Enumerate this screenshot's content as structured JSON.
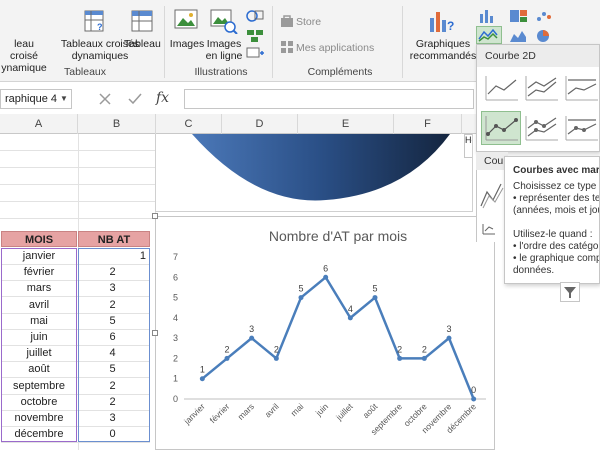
{
  "ribbon": {
    "tables": {
      "pivot_partial": "leau croisé",
      "pivot_partial2": "ynamique",
      "recommended_pivot_line1": "Tableaux croisés",
      "recommended_pivot_line2": "dynamiques",
      "table_partial": "Tableau",
      "group_label": "Tableaux"
    },
    "illustrations": {
      "images": "Images",
      "online_images_line1": "Images",
      "online_images_line2": "en ligne",
      "group_label": "Illustrations"
    },
    "addins": {
      "store": "Store",
      "my_apps": "Mes applications",
      "group_label": "Compléments"
    },
    "charts": {
      "recommended_line1": "Graphiques",
      "recommended_line2": "recommandés"
    }
  },
  "formula_bar": {
    "namebox": "raphique 4",
    "fx": "fx"
  },
  "columns": [
    "A",
    "B",
    "C",
    "D",
    "E",
    "F"
  ],
  "table": {
    "header_mois": "MOIS",
    "header_nb": "NB AT",
    "rows": [
      {
        "mois": "janvier",
        "nb": "1"
      },
      {
        "mois": "février",
        "nb": "2"
      },
      {
        "mois": "mars",
        "nb": "3"
      },
      {
        "mois": "avril",
        "nb": "2"
      },
      {
        "mois": "mai",
        "nb": "5"
      },
      {
        "mois": "juin",
        "nb": "6"
      },
      {
        "mois": "juillet",
        "nb": "4"
      },
      {
        "mois": "août",
        "nb": "5"
      },
      {
        "mois": "septembre",
        "nb": "2"
      },
      {
        "mois": "octobre",
        "nb": "2"
      },
      {
        "mois": "novembre",
        "nb": "3"
      },
      {
        "mois": "décembre",
        "nb": "0"
      }
    ]
  },
  "dropdown": {
    "header_2d": "Courbe 2D",
    "header_3d_partial": "Cou"
  },
  "tooltip": {
    "title": "Courbes avec marq",
    "lines": [
      "Choisissez ce type d",
      "• représenter des ten",
      "(années, mois et jou",
      "",
      "Utilisez-le quand :",
      "• l'ordre des catégor",
      "• le graphique comp",
      "données."
    ]
  },
  "chart_data": {
    "type": "line",
    "title": "Nombre d'AT par mois",
    "categories": [
      "janvier",
      "février",
      "mars",
      "avril",
      "mai",
      "juin",
      "juillet",
      "août",
      "septembre",
      "octobre",
      "novembre",
      "décembre"
    ],
    "values": [
      1,
      2,
      3,
      2,
      5,
      6,
      4,
      5,
      2,
      2,
      3,
      0
    ],
    "ylim": [
      0,
      7
    ],
    "yticks": [
      0,
      1,
      2,
      3,
      4,
      5,
      6,
      7
    ],
    "grid": false,
    "data_labels": true,
    "line_color": "#4a7ebb"
  },
  "colors": {
    "header_fill": "#e6a3a3",
    "series": "#4a7ebb",
    "selected_thumb": "#cfe5cf"
  }
}
